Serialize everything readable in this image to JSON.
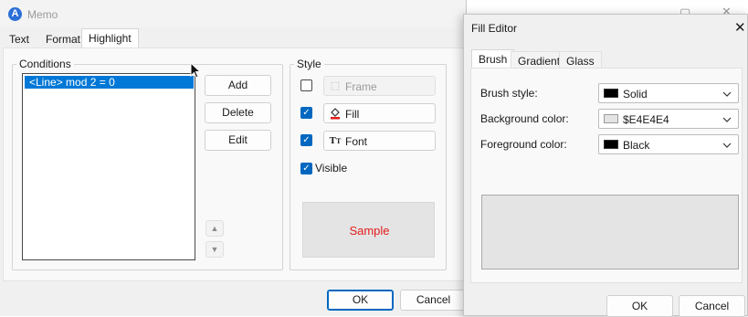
{
  "memo": {
    "title": "Memo",
    "app_icon_letter": "A",
    "tabs": [
      "Text",
      "Format",
      "Highlight"
    ],
    "active_tab": "Highlight",
    "conditions": {
      "group_label": "Conditions",
      "items": [
        "<Line> mod 2 = 0"
      ],
      "selected_index": 0
    },
    "buttons": {
      "add": "Add",
      "delete": "Delete",
      "edit": "Edit"
    },
    "style": {
      "group_label": "Style",
      "frame": {
        "label": "Frame",
        "checked": false,
        "enabled": false
      },
      "fill": {
        "label": "Fill",
        "checked": true
      },
      "font": {
        "label": "Font",
        "checked": true
      },
      "visible": {
        "label": "Visible",
        "checked": true
      },
      "sample_text": "Sample",
      "sample_text_color": "#e31b1b",
      "sample_bg_color": "#E4E4E4"
    },
    "footer": {
      "ok": "OK",
      "cancel": "Cancel"
    }
  },
  "fill_editor": {
    "title": "Fill Editor",
    "tabs": [
      "Brush",
      "Gradient",
      "Glass"
    ],
    "active_tab": "Brush",
    "fields": {
      "brush_style": {
        "label": "Brush style:",
        "value": "Solid",
        "swatch": "#000000"
      },
      "background_color": {
        "label": "Background color:",
        "value": "$E4E4E4",
        "swatch": "#E4E4E4"
      },
      "foreground_color": {
        "label": "Foreground color:",
        "value": "Black",
        "swatch": "#000000"
      }
    },
    "preview_color": "#E4E4E4",
    "footer": {
      "ok": "OK",
      "cancel": "Cancel"
    }
  },
  "colors": {
    "accent": "#0078d7",
    "checkbox": "#0067c0"
  }
}
